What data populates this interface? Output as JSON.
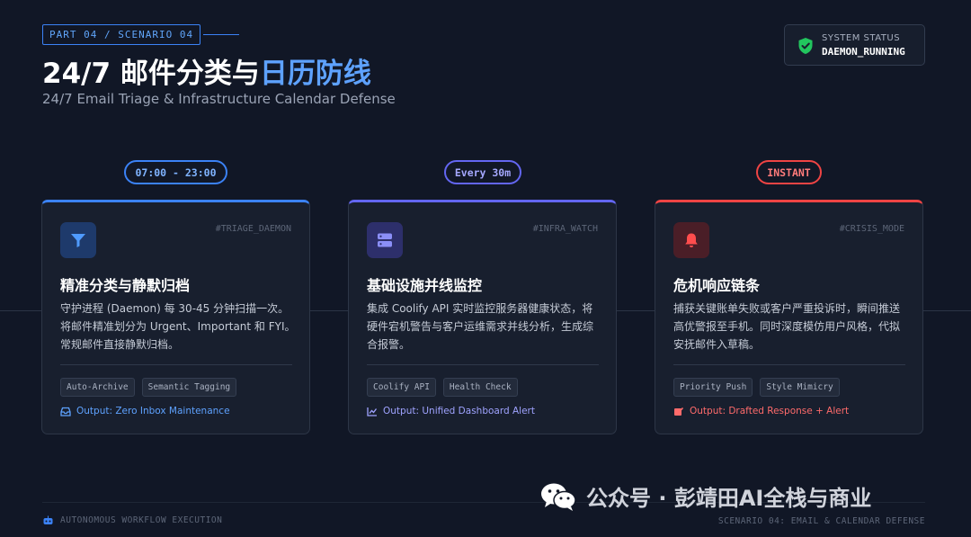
{
  "header": {
    "part_tag": "PART 04 / SCENARIO 04",
    "title_main": "24/7 邮件分类与",
    "title_accent": "日历防线",
    "subtitle": "24/7 Email Triage & Infrastructure Calendar Defense"
  },
  "status": {
    "label": "SYSTEM STATUS",
    "value": "DAEMON_RUNNING",
    "icon": "shield-check-icon",
    "color": "#22c55e"
  },
  "cards": [
    {
      "schedule": "07:00 - 23:00",
      "accent": "#3b82f6",
      "icon": "filter-icon",
      "hashtag": "#TRIAGE_DAEMON",
      "title": "精准分类与静默归档",
      "description": "守护进程 (Daemon) 每 30-45 分钟扫描一次。将邮件精准划分为 Urgent、Important 和 FYI。常规邮件直接静默归档。",
      "tags": [
        "Auto-Archive",
        "Semantic Tagging"
      ],
      "output": "Output: Zero Inbox Maintenance",
      "output_icon": "inbox-icon"
    },
    {
      "schedule": "Every 30m",
      "accent": "#6366f1",
      "icon": "server-icon",
      "hashtag": "#INFRA_WATCH",
      "title": "基础设施并线监控",
      "description": "集成 Coolify API 实时监控服务器健康状态，将硬件宕机警告与客户运维需求并线分析，生成综合报警。",
      "tags": [
        "Coolify API",
        "Health Check"
      ],
      "output": "Output: Unified Dashboard Alert",
      "output_icon": "chart-line-icon"
    },
    {
      "schedule": "INSTANT",
      "accent": "#ef4444",
      "icon": "bell-icon",
      "hashtag": "#CRISIS_MODE",
      "title": "危机响应链条",
      "description": "捕获关键账单失败或客户严重投诉时，瞬间推送高优警报至手机。同时深度模仿用户风格，代拟安抚邮件入草稿。",
      "tags": [
        "Priority Push",
        "Style Mimicry"
      ],
      "output": "Output: Drafted Response + Alert",
      "output_icon": "pen-square-icon"
    }
  ],
  "footer": {
    "left": "AUTONOMOUS WORKFLOW EXECUTION",
    "left_icon": "robot-icon",
    "right": "SCENARIO 04: EMAIL & CALENDAR DEFENSE"
  },
  "watermark": {
    "text": "公众号 · 彭靖田AI全栈与商业",
    "icon": "wechat-icon"
  }
}
